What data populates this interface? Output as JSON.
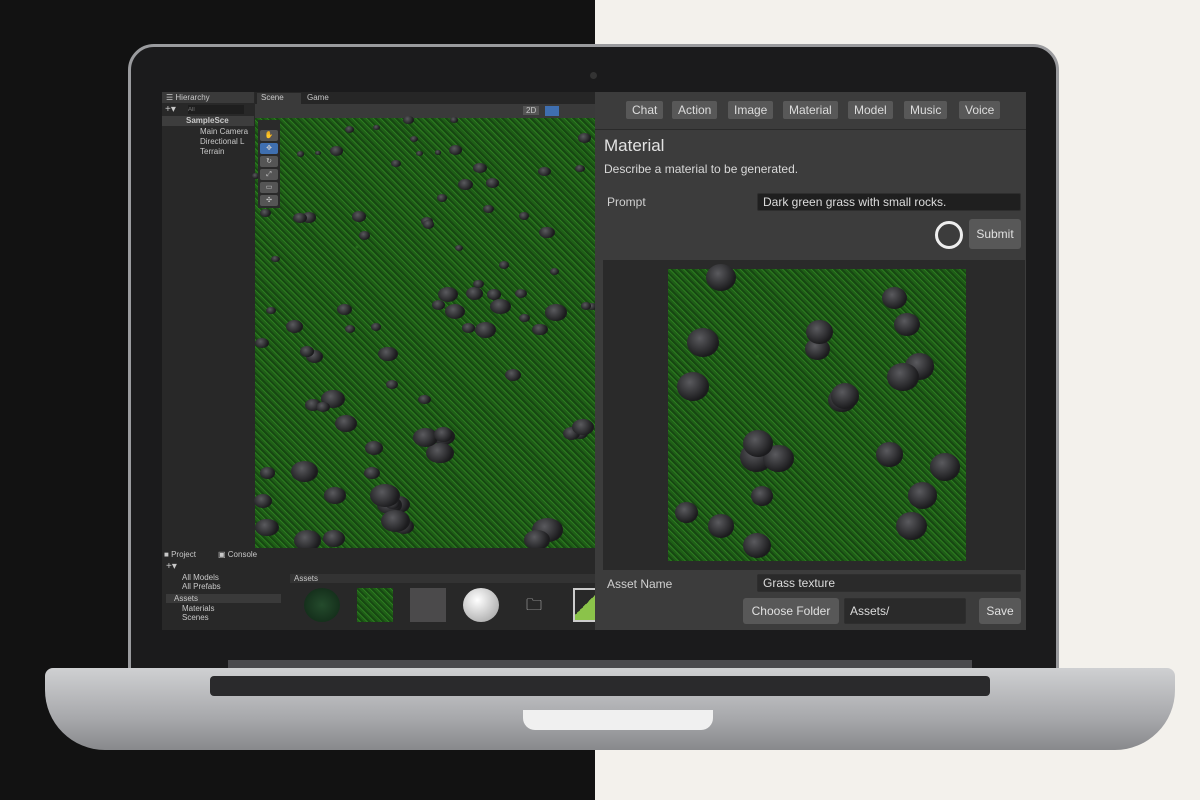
{
  "hierarchy": {
    "tab": "Hierarchy",
    "search_placeholder": "All",
    "scene": "SampleSce",
    "items": [
      "Main Camera",
      "Directional L",
      "Terrain"
    ]
  },
  "scene_tabs": [
    "Scene",
    "Game"
  ],
  "scene_toolbar": {
    "mode_2d": "2D"
  },
  "project": {
    "tabs": [
      "Project",
      "Console"
    ],
    "favorites": [
      "All Models",
      "All Prefabs"
    ],
    "assets_root": "Assets",
    "folders": [
      "Materials",
      "Scenes"
    ],
    "breadcrumb": "Assets"
  },
  "plugin": {
    "tabs": [
      "Chat",
      "Action",
      "Image",
      "Material",
      "Model",
      "Music",
      "Voice"
    ],
    "title": "Material",
    "description": "Describe a material to be generated.",
    "prompt_label": "Prompt",
    "prompt_value": "Dark green grass with small rocks.",
    "submit": "Submit",
    "asset_name_label": "Asset Name",
    "asset_name_value": "Grass texture",
    "choose_folder": "Choose Folder",
    "folder_value": "Assets/",
    "save": "Save"
  }
}
